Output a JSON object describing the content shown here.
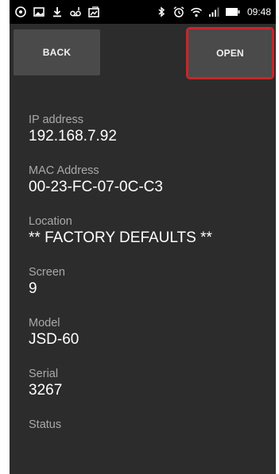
{
  "status_bar": {
    "time": "09:48",
    "left_icons": [
      "settings-icon",
      "image-icon",
      "download-icon",
      "voicemail-icon",
      "gallery-icon"
    ],
    "right_icons": [
      "bluetooth-icon",
      "alarm-icon",
      "wifi-icon",
      "signal-icon",
      "battery-icon"
    ]
  },
  "toolbar": {
    "back_label": "BACK",
    "open_label": "OPEN",
    "open_highlight_color": "#c8262b"
  },
  "device": {
    "ip_label": "IP address",
    "ip_value": "192.168.7.92",
    "mac_label": "MAC Address",
    "mac_value": "00-23-FC-07-0C-C3",
    "location_label": "Location",
    "location_value": "** FACTORY DEFAULTS **",
    "screen_label": "Screen",
    "screen_value": "9",
    "model_label": "Model",
    "model_value": "JSD-60",
    "serial_label": "Serial",
    "serial_value": "3267",
    "status_label": "Status",
    "status_value": ""
  }
}
